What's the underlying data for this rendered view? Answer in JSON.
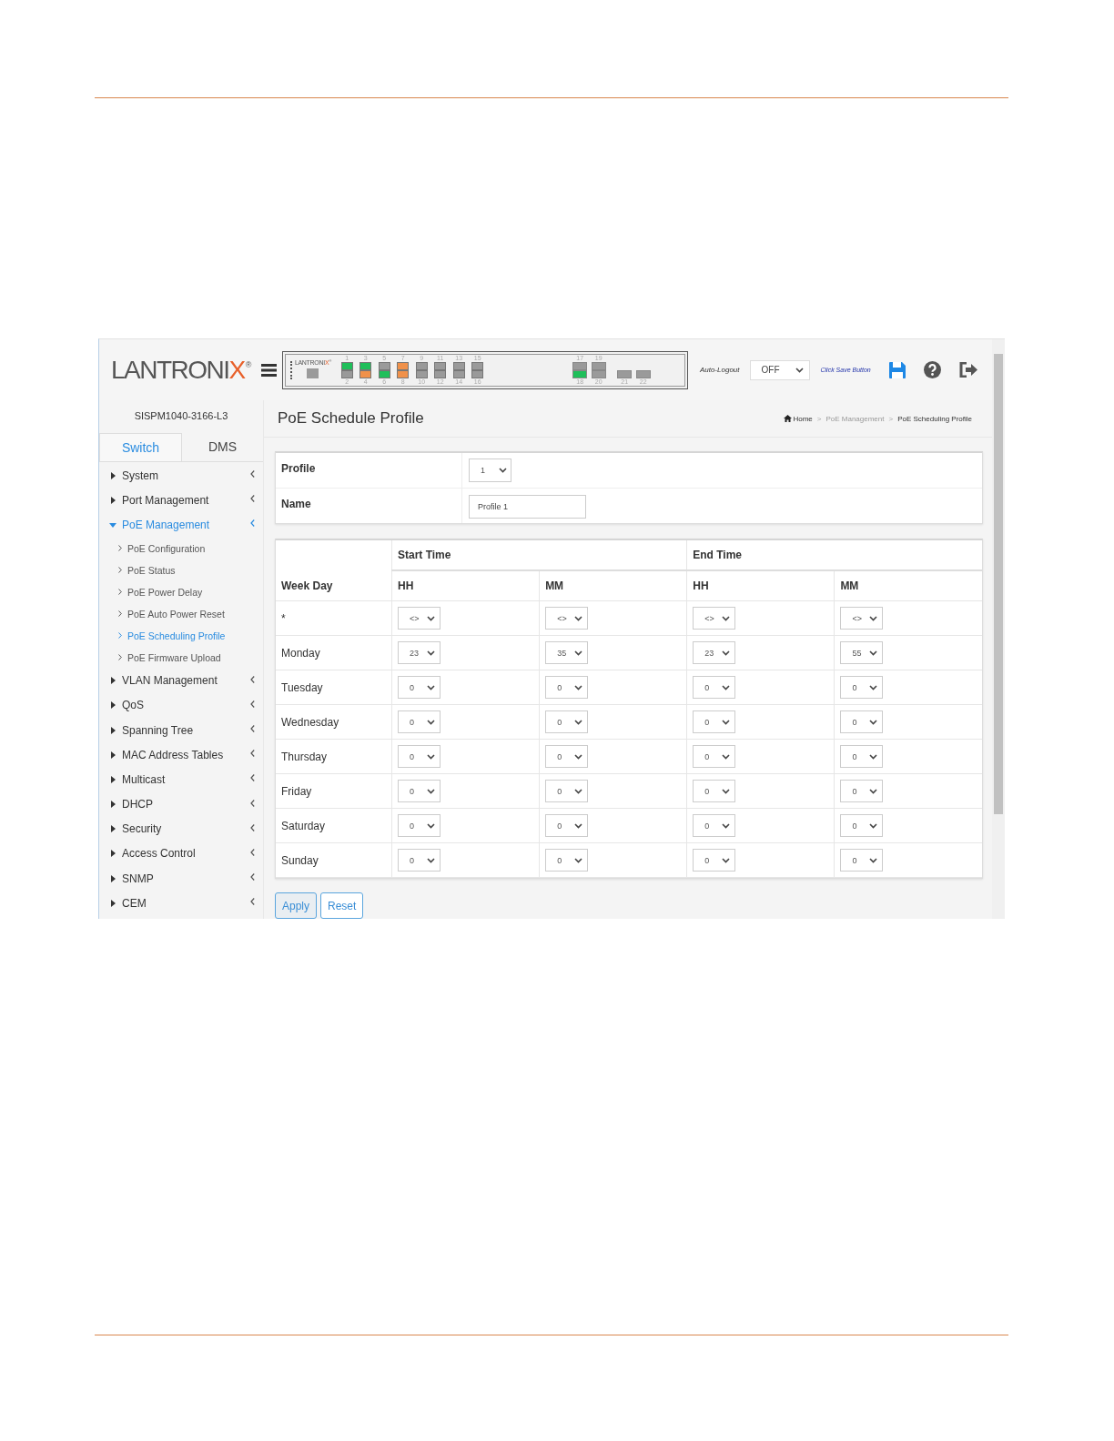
{
  "header": {
    "logo": {
      "main": "LANTRONI",
      "accent": "X",
      "mark": "®"
    },
    "auto_logout_label": "Auto-Logout",
    "auto_logout_value": "OFF",
    "save_hint": "Click Save Button"
  },
  "port_panel": {
    "brand": {
      "main": "LANTRONI",
      "accent": "X",
      "mark": "®"
    },
    "columns": [
      {
        "kind": "rj45",
        "top": {
          "label": "1",
          "color": "#1fbf5a"
        },
        "bottom": {
          "label": "2",
          "color": "#9a9a9a"
        }
      },
      {
        "kind": "rj45",
        "top": {
          "label": "3",
          "color": "#1fbf5a"
        },
        "bottom": {
          "label": "4",
          "color": "#f0914a"
        }
      },
      {
        "kind": "rj45",
        "top": {
          "label": "5",
          "color": "#9a9a9a"
        },
        "bottom": {
          "label": "6",
          "color": "#1fbf5a"
        }
      },
      {
        "kind": "rj45",
        "top": {
          "label": "7",
          "color": "#f0914a"
        },
        "bottom": {
          "label": "8",
          "color": "#f0914a"
        }
      },
      {
        "kind": "rj45",
        "top": {
          "label": "9",
          "color": "#9a9a9a"
        },
        "bottom": {
          "label": "10",
          "color": "#9a9a9a"
        }
      },
      {
        "kind": "rj45",
        "top": {
          "label": "11",
          "color": "#9a9a9a"
        },
        "bottom": {
          "label": "12",
          "color": "#9a9a9a"
        }
      },
      {
        "kind": "rj45",
        "top": {
          "label": "13",
          "color": "#9a9a9a"
        },
        "bottom": {
          "label": "14",
          "color": "#9a9a9a"
        }
      },
      {
        "kind": "rj45",
        "top": {
          "label": "15",
          "color": "#9a9a9a"
        },
        "bottom": {
          "label": "16",
          "color": "#9a9a9a"
        }
      },
      {
        "kind": "sfp",
        "top": {
          "label": "17",
          "color": "#9a9a9a"
        },
        "bottom": {
          "label": "18",
          "color": "#1fbf5a"
        }
      },
      {
        "kind": "sfp",
        "top": {
          "label": "19",
          "color": "#9a9a9a"
        },
        "bottom": {
          "label": "20",
          "color": "#9a9a9a"
        }
      },
      {
        "kind": "sfp_single",
        "bottom": {
          "label": "21",
          "color": "#9a9a9a"
        }
      },
      {
        "kind": "sfp_single",
        "bottom": {
          "label": "22",
          "color": "#9a9a9a"
        }
      }
    ]
  },
  "sidebar": {
    "device_name": "SISPM1040-3166-L3",
    "tabs": [
      {
        "label": "Switch",
        "selected": true
      },
      {
        "label": "DMS",
        "selected": false
      }
    ],
    "menu": [
      {
        "label": "System",
        "expanded": false
      },
      {
        "label": "Port Management",
        "expanded": false
      },
      {
        "label": "PoE Management",
        "expanded": true,
        "children": [
          {
            "label": "PoE Configuration",
            "selected": false
          },
          {
            "label": "PoE Status",
            "selected": false
          },
          {
            "label": "PoE Power Delay",
            "selected": false
          },
          {
            "label": "PoE Auto Power Reset",
            "selected": false
          },
          {
            "label": "PoE Scheduling Profile",
            "selected": true
          },
          {
            "label": "PoE Firmware Upload",
            "selected": false
          }
        ]
      },
      {
        "label": "VLAN Management",
        "expanded": false
      },
      {
        "label": "QoS",
        "expanded": false
      },
      {
        "label": "Spanning Tree",
        "expanded": false
      },
      {
        "label": "MAC Address Tables",
        "expanded": false
      },
      {
        "label": "Multicast",
        "expanded": false
      },
      {
        "label": "DHCP",
        "expanded": false
      },
      {
        "label": "Security",
        "expanded": false
      },
      {
        "label": "Access Control",
        "expanded": false
      },
      {
        "label": "SNMP",
        "expanded": false
      },
      {
        "label": "CEM",
        "expanded": false
      }
    ]
  },
  "page_title": "PoE Schedule Profile",
  "breadcrumb": [
    {
      "kind": "home",
      "text": "Home"
    },
    {
      "kind": "separator",
      "text": ">"
    },
    {
      "kind": "link",
      "text": "PoE Management"
    },
    {
      "kind": "separator",
      "text": ">"
    },
    {
      "kind": "current",
      "text": "PoE Scheduling Profile"
    }
  ],
  "profile_form": {
    "profile_label": "Profile",
    "profile_value": "1",
    "name_label": "Name",
    "name_value": "Profile 1"
  },
  "schedule_table": {
    "weekday_header": "Week Day",
    "start_header": "Start Time",
    "end_header": "End Time",
    "sub_headers": [
      "HH",
      "MM",
      "HH",
      "MM"
    ],
    "rows": [
      {
        "day": "*",
        "values": [
          "<>",
          "<>",
          "<>",
          "<>"
        ]
      },
      {
        "day": "Monday",
        "values": [
          "23",
          "35",
          "23",
          "55"
        ]
      },
      {
        "day": "Tuesday",
        "values": [
          "0",
          "0",
          "0",
          "0"
        ]
      },
      {
        "day": "Wednesday",
        "values": [
          "0",
          "0",
          "0",
          "0"
        ]
      },
      {
        "day": "Thursday",
        "values": [
          "0",
          "0",
          "0",
          "0"
        ]
      },
      {
        "day": "Friday",
        "values": [
          "0",
          "0",
          "0",
          "0"
        ]
      },
      {
        "day": "Saturday",
        "values": [
          "0",
          "0",
          "0",
          "0"
        ]
      },
      {
        "day": "Sunday",
        "values": [
          "0",
          "0",
          "0",
          "0"
        ]
      }
    ]
  },
  "buttons": [
    "Apply",
    "Reset"
  ]
}
